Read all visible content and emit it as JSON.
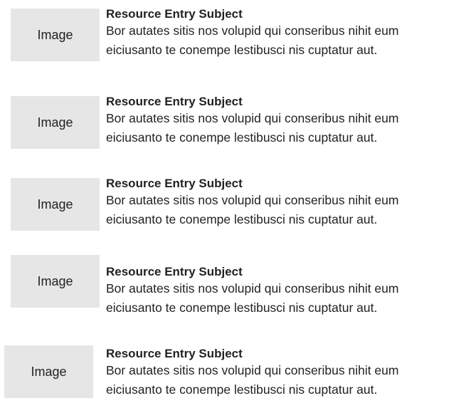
{
  "entries": [
    {
      "image_label": "Image",
      "subject": "Resource Entry Subject",
      "line1": "Bor autates sitis nos volupid qui conseribus nihit eum",
      "line2": "eiciusanto te conempe lestibusci nis cuptatur aut."
    },
    {
      "image_label": "Image",
      "subject": "Resource Entry Subject",
      "line1": "Bor autates sitis nos volupid qui conseribus nihit eum",
      "line2": "eiciusanto te conempe lestibusci nis cuptatur aut."
    },
    {
      "image_label": "Image",
      "subject": "Resource Entry Subject",
      "line1": "Bor autates sitis nos volupid qui conseribus nihit eum",
      "line2": "eiciusanto te conempe lestibusci nis cuptatur aut."
    },
    {
      "image_label": "Image",
      "subject": "Resource Entry Subject",
      "line1": "Bor autates sitis nos volupid qui conseribus nihit eum",
      "line2": "eiciusanto te conempe lestibusci nis cuptatur aut."
    },
    {
      "image_label": "Image",
      "subject": "Resource Entry Subject",
      "line1": "Bor autates sitis nos volupid qui conseribus nihit eum",
      "line2": "eiciusanto te conempe lestibusci nis cuptatur aut."
    }
  ]
}
